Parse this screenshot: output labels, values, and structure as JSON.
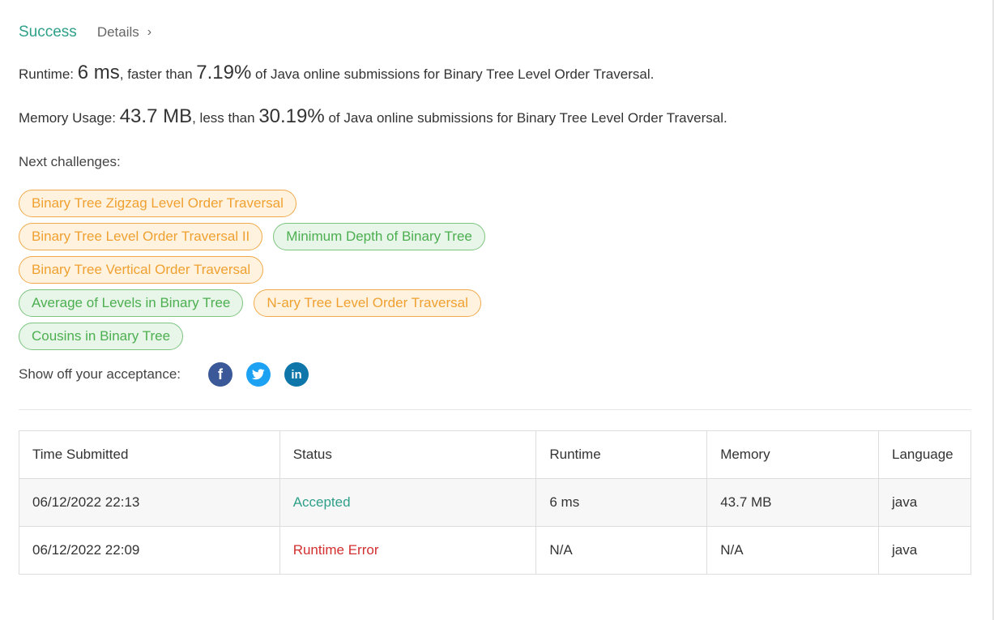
{
  "header": {
    "status": "Success",
    "details_label": "Details",
    "chevron": "›"
  },
  "runtime": {
    "label": "Runtime: ",
    "value": "6 ms",
    "mid": ", faster than ",
    "percent": "7.19%",
    "suffix": " of Java online submissions for Binary Tree Level Order Traversal."
  },
  "memory": {
    "label": "Memory Usage: ",
    "value": "43.7 MB",
    "mid": ", less than ",
    "percent": "30.19%",
    "suffix": " of Java online submissions for Binary Tree Level Order Traversal."
  },
  "next": {
    "label": "Next challenges:",
    "tags": [
      "Binary Tree Zigzag Level Order Traversal",
      "Binary Tree Level Order Traversal II",
      "Minimum Depth of Binary Tree",
      "Binary Tree Vertical Order Traversal",
      "Average of Levels in Binary Tree",
      "N-ary Tree Level Order Traversal",
      "Cousins in Binary Tree"
    ]
  },
  "share": {
    "label": "Show off your acceptance:",
    "icons": [
      "facebook-icon",
      "twitter-icon",
      "linkedin-icon"
    ],
    "facebook_glyph": "f",
    "linkedin_glyph": "in"
  },
  "table": {
    "headers": [
      "Time Submitted",
      "Status",
      "Runtime",
      "Memory",
      "Language"
    ],
    "rows": [
      [
        "06/12/2022 22:13",
        "Accepted",
        "6 ms",
        "43.7 MB",
        "java"
      ],
      [
        "06/12/2022 22:09",
        "Runtime Error",
        "N/A",
        "N/A",
        "java"
      ]
    ]
  },
  "colors": {
    "success": "#2ea089",
    "error": "#d32f2f",
    "medium_tag": "#f0a030",
    "easy_tag": "#4caf50"
  }
}
